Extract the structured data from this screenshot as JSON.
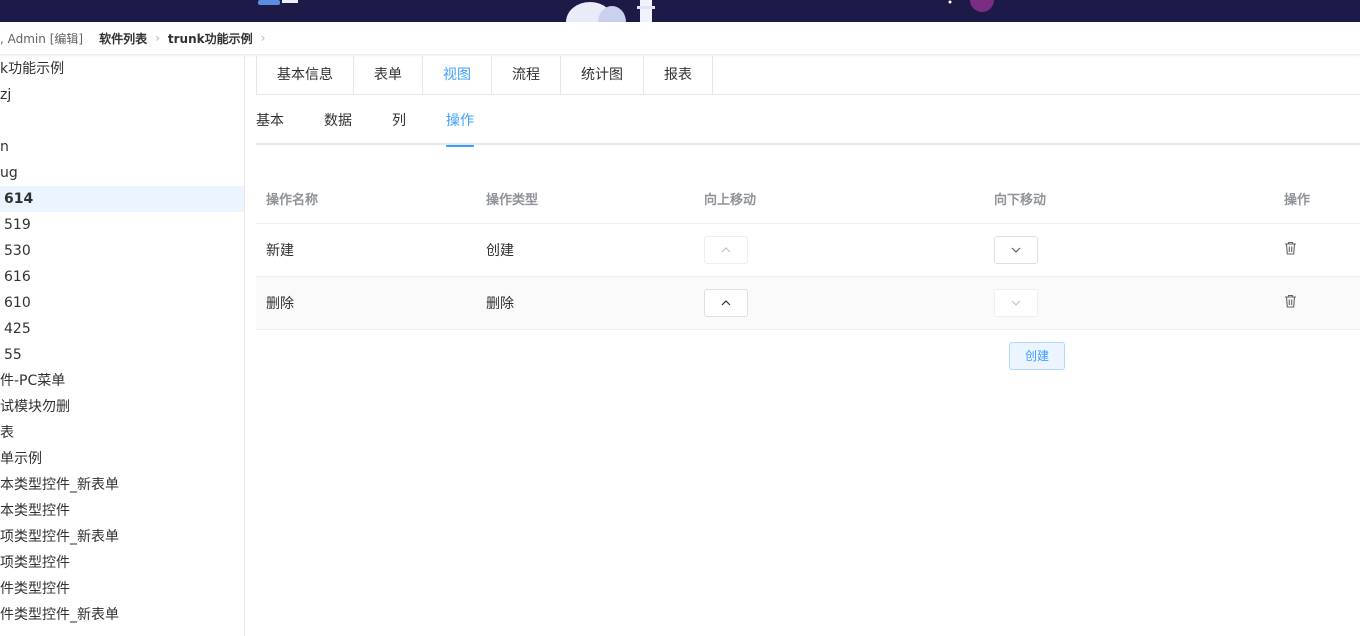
{
  "breadcrumb": {
    "user": ", Admin [编辑]",
    "items": [
      "软件列表",
      "trunk功能示例"
    ]
  },
  "sidebar": {
    "items": [
      {
        "label": "k功能示例"
      },
      {
        "label": "zj"
      },
      {
        "label": ""
      },
      {
        "label": "n"
      },
      {
        "label": "ug"
      },
      {
        "label": "614"
      },
      {
        "label": "519"
      },
      {
        "label": "530"
      },
      {
        "label": "616"
      },
      {
        "label": "610"
      },
      {
        "label": "425"
      },
      {
        "label": "55"
      },
      {
        "label": "件-PC菜单"
      },
      {
        "label": "试模块勿删"
      },
      {
        "label": "表"
      },
      {
        "label": "单示例"
      },
      {
        "label": "本类型控件_新表单"
      },
      {
        "label": "本类型控件"
      },
      {
        "label": "项类型控件_新表单"
      },
      {
        "label": "项类型控件"
      },
      {
        "label": "件类型控件"
      },
      {
        "label": "件类型控件_新表单"
      }
    ]
  },
  "tabs": [
    "基本信息",
    "表单",
    "视图",
    "流程",
    "统计图",
    "报表"
  ],
  "subtabs": [
    "基本",
    "数据",
    "列",
    "操作"
  ],
  "table": {
    "headers": [
      "操作名称",
      "操作类型",
      "向上移动",
      "向下移动",
      "操作"
    ],
    "rows": [
      {
        "name": "新建",
        "type": "创建"
      },
      {
        "name": "删除",
        "type": "删除"
      }
    ]
  },
  "create_button": "创建",
  "colors": {
    "accent": "#409eff",
    "banner": "#1d1a47"
  }
}
